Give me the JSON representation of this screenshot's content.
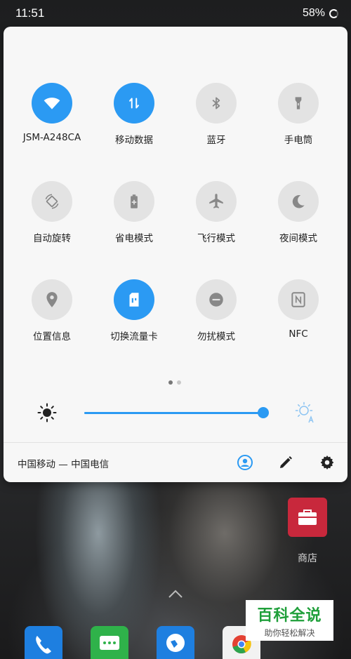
{
  "status_bar": {
    "time": "11:51",
    "battery": "58%"
  },
  "tiles": [
    {
      "label": "JSM-A248CA",
      "icon": "wifi-icon",
      "active": true
    },
    {
      "label": "移动数据",
      "icon": "mobile-data-icon",
      "active": true
    },
    {
      "label": "蓝牙",
      "icon": "bluetooth-icon",
      "active": false
    },
    {
      "label": "手电筒",
      "icon": "flashlight-icon",
      "active": false
    },
    {
      "label": "自动旋转",
      "icon": "auto-rotate-icon",
      "active": false
    },
    {
      "label": "省电模式",
      "icon": "battery-saver-icon",
      "active": false
    },
    {
      "label": "飞行模式",
      "icon": "airplane-icon",
      "active": false
    },
    {
      "label": "夜间模式",
      "icon": "moon-icon",
      "active": false
    },
    {
      "label": "位置信息",
      "icon": "location-icon",
      "active": false
    },
    {
      "label": "切换流量卡",
      "icon": "sim-card-icon",
      "active": true
    },
    {
      "label": "勿扰模式",
      "icon": "do-not-disturb-icon",
      "active": false
    },
    {
      "label": "NFC",
      "icon": "nfc-icon",
      "active": false
    }
  ],
  "pager": {
    "pages": 2,
    "current": 1
  },
  "brightness": {
    "level": 0.98
  },
  "footer": {
    "carrier": "中国移动 — 中国电信"
  },
  "home": {
    "store_label": "商店"
  },
  "watermark": {
    "title": "百科全说",
    "subtitle": "助你轻松解决"
  },
  "colors": {
    "accent": "#2b9af3",
    "tile_off": "#e3e3e3",
    "panel": "#f7f7f7"
  }
}
